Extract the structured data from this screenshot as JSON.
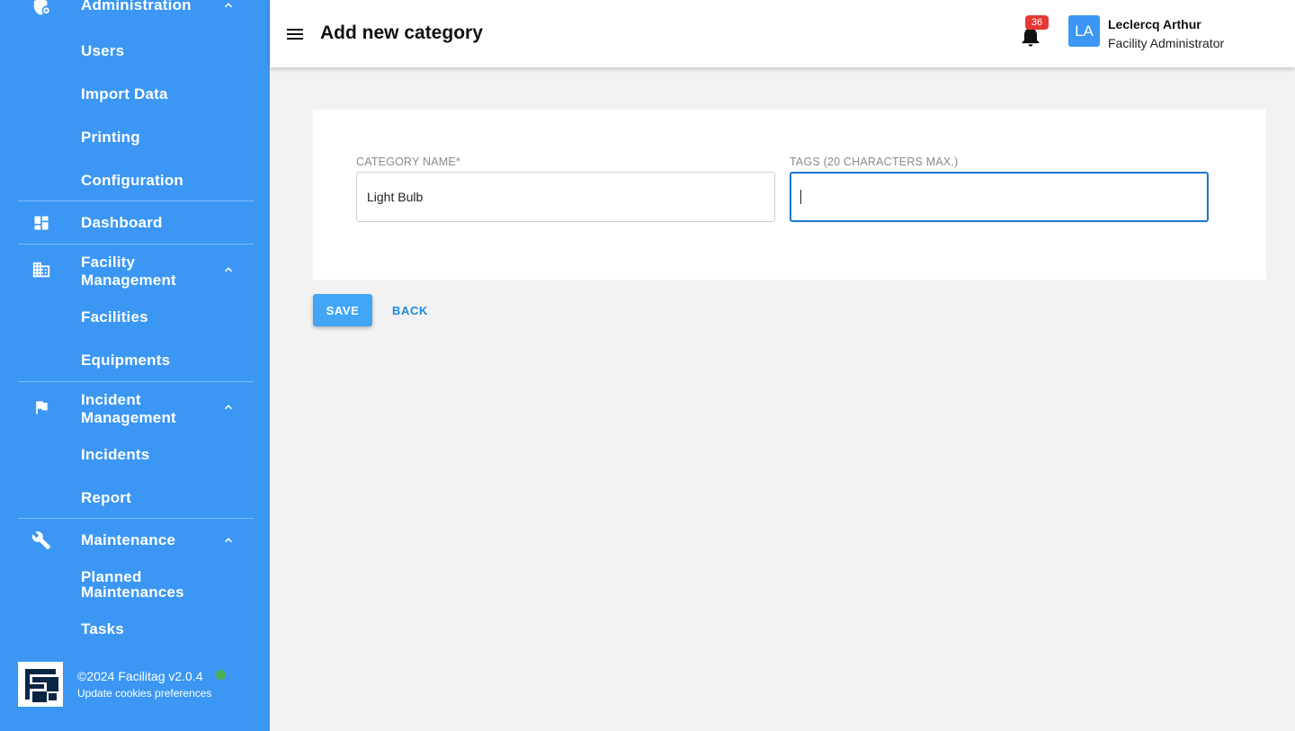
{
  "sidebar": {
    "administration": {
      "label": "Administration",
      "icon": "admin-shield-icon"
    },
    "admin_items": [
      "Users",
      "Import Data",
      "Printing",
      "Configuration"
    ],
    "dashboard": {
      "label": "Dashboard",
      "icon": "dashboard-icon"
    },
    "facility": {
      "label": "Facility Management",
      "label_line1": "Facility",
      "label_line2": "Management",
      "icon": "building-icon"
    },
    "facility_items": [
      "Facilities",
      "Equipments"
    ],
    "incident": {
      "label": "Incident Management",
      "label_line1": "Incident",
      "label_line2": "Management",
      "icon": "flag-icon"
    },
    "incident_items": [
      "Incidents",
      "Report"
    ],
    "maintenance": {
      "label": "Maintenance",
      "icon": "wrench-icon"
    },
    "maintenance_items": [
      {
        "line1": "Planned",
        "line2": "Maintenances"
      },
      "Tasks"
    ],
    "footer": {
      "copyright": "©2024 Facilitag  v2.0.4",
      "cookies": "Update cookies preferences",
      "status_color": "#4caf50"
    }
  },
  "header": {
    "title": "Add new category",
    "notifications": "36",
    "avatar": "LA",
    "user_name": "Leclercq Arthur",
    "user_role": "Facility Administrator"
  },
  "form": {
    "category_label": "CATEGORY NAME*",
    "category_value": "Light Bulb",
    "tags_label": "TAGS (20 CHARACTERS MAX.)",
    "tags_value": ""
  },
  "actions": {
    "save": "SAVE",
    "back": "BACK"
  },
  "colors": {
    "sidebar": "#3b97f3",
    "accent": "#1976d2",
    "badge": "#e53935"
  }
}
